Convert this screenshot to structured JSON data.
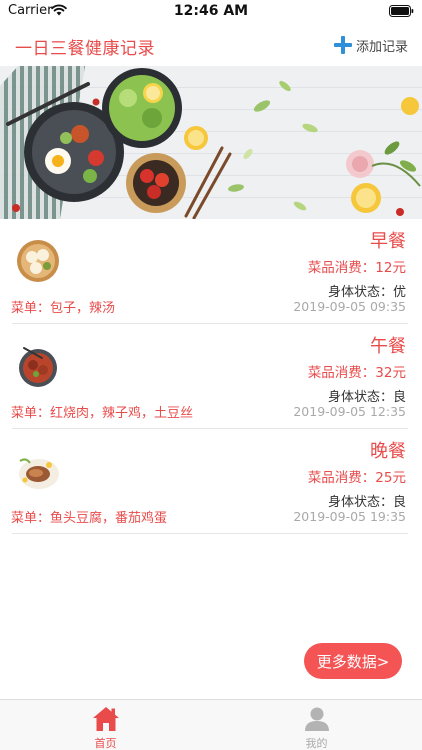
{
  "status_bar": {
    "carrier": "Carrier",
    "time": "12:46 AM"
  },
  "nav": {
    "title": "一日三餐健康记录",
    "add_label": "添加记录",
    "accent": "#e94b4b",
    "add_icon_color": "#2f8fd8"
  },
  "banner": {
    "icon": "food-banner-image"
  },
  "meals": [
    {
      "title": "早餐",
      "cost": "菜品消费：12元",
      "status": "身体状态：优",
      "menu": "菜单：包子，辣汤",
      "time": "2019-09-05 09:35",
      "icon": "buns-plate-icon"
    },
    {
      "title": "午餐",
      "cost": "菜品消费：32元",
      "status": "身体状态：良",
      "menu": "菜单：红烧肉，辣子鸡，土豆丝",
      "time": "2019-09-05 12:35",
      "icon": "meat-bowl-icon"
    },
    {
      "title": "晚餐",
      "cost": "菜品消费：25元",
      "status": "身体状态：良",
      "menu": "菜单：鱼头豆腐，番茄鸡蛋",
      "time": "2019-09-05 19:35",
      "icon": "fish-dish-icon"
    }
  ],
  "more_button": "更多数据>",
  "tabs": [
    {
      "label": "首页",
      "icon": "home-icon",
      "active": true,
      "color": "#e94b4b"
    },
    {
      "label": "我的",
      "icon": "profile-icon",
      "active": false,
      "color": "#aaaaaa"
    }
  ]
}
